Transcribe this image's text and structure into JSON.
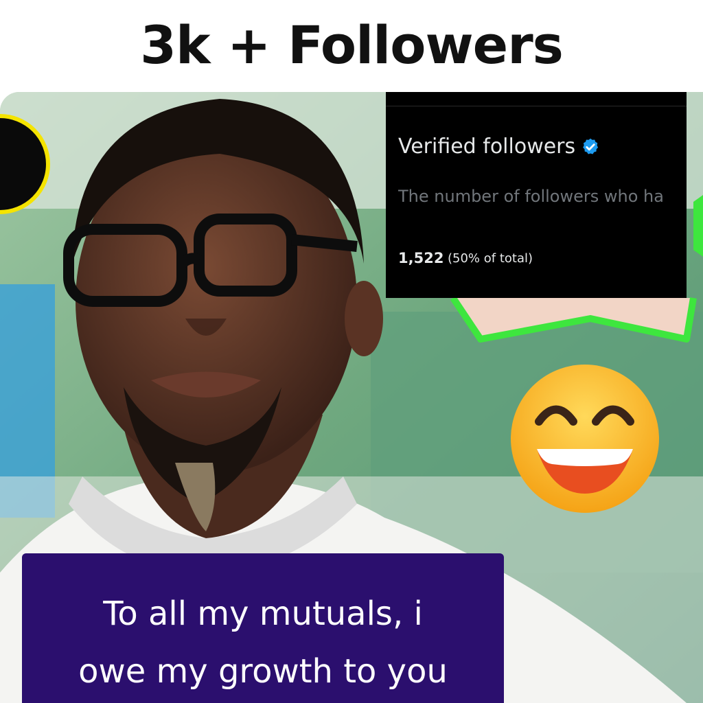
{
  "headline": "3k + Followers",
  "stats_card": {
    "title": "Verified followers",
    "badge_icon": "verified-badge-icon",
    "description": "The number of followers who ha",
    "count": "1,522",
    "percent_text": "(50% of total)"
  },
  "caption": {
    "line1": "To all my mutuals, i",
    "line2": "owe my growth to you"
  },
  "colors": {
    "caption_bg": "#2b0f6e",
    "card_bg": "#000000",
    "verified_blue": "#1d9bf0",
    "green_outline": "#3ee63e",
    "yellow_ring": "#f5e400"
  },
  "emoji": "grinning-face-with-smiling-eyes-icon"
}
